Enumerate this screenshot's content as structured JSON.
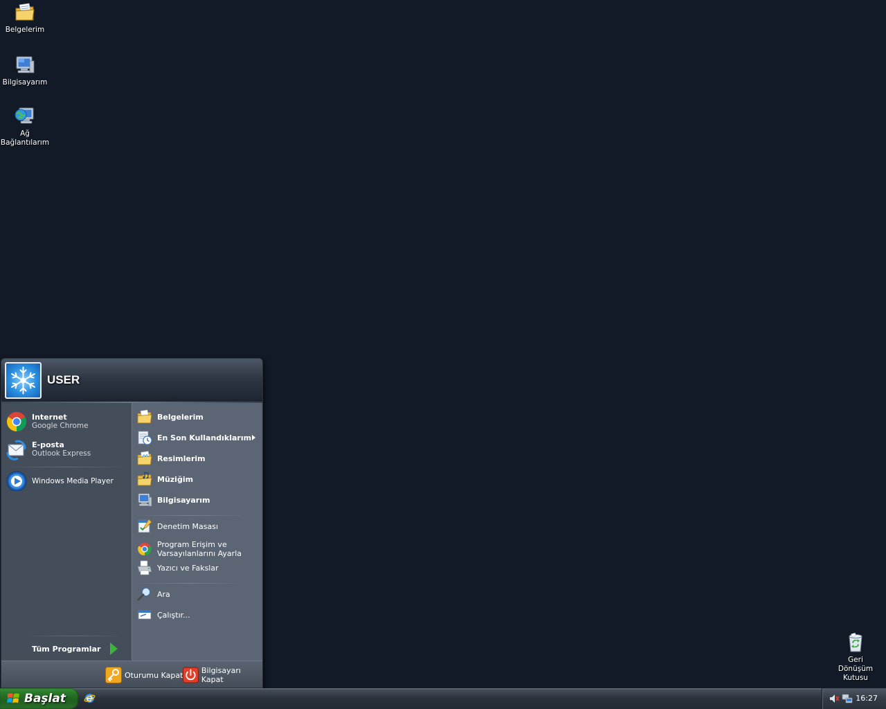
{
  "desktop": {
    "icons": [
      {
        "label": "Belgelerim"
      },
      {
        "label": "Bilgisayarım"
      },
      {
        "label_line1": "Ağ",
        "label_line2": "Bağlantılarım"
      },
      {
        "label_line1": "Geri Dönüşüm",
        "label_line2": "Kutusu"
      }
    ]
  },
  "start_menu": {
    "username": "USER",
    "pinned": [
      {
        "title": "Internet",
        "subtitle": "Google Chrome",
        "icon": "chrome-icon"
      },
      {
        "title": "E-posta",
        "subtitle": "Outlook Express",
        "icon": "outlook-express-icon"
      }
    ],
    "recent": [
      {
        "title": "Windows Media Player",
        "icon": "windows-media-player-icon"
      }
    ],
    "all_programs": "Tüm Programlar",
    "places": [
      {
        "label": "Belgelerim",
        "icon": "documents-folder-icon"
      },
      {
        "label": "En Son Kullandıklarım",
        "icon": "recent-documents-icon"
      },
      {
        "label": "Resimlerim",
        "icon": "pictures-folder-icon"
      },
      {
        "label": "Müziğim",
        "icon": "music-folder-icon"
      },
      {
        "label": "Bilgisayarım",
        "icon": "my-computer-icon"
      }
    ],
    "settings": [
      {
        "label": "Denetim Masası",
        "icon": "control-panel-icon"
      },
      {
        "label_line1": "Program Erişim ve",
        "label_line2": "Varsayılanlarını Ayarla",
        "icon": "program-access-icon"
      },
      {
        "label": "Yazıcı ve Fakslar",
        "icon": "printer-icon"
      }
    ],
    "tools": [
      {
        "label": "Ara",
        "icon": "search-icon"
      },
      {
        "label": "Çalıştır...",
        "icon": "run-icon"
      }
    ],
    "footer": {
      "logoff": "Oturumu Kapat",
      "shutdown": "Bilgisayarı Kapat"
    }
  },
  "taskbar": {
    "start_label": "Başlat",
    "clock": "16:27"
  },
  "colors": {
    "desktop_bg": "#121a27",
    "start_button": "#2b7a2b",
    "menu_left": "#444d5a",
    "menu_right": "#5c6574"
  }
}
